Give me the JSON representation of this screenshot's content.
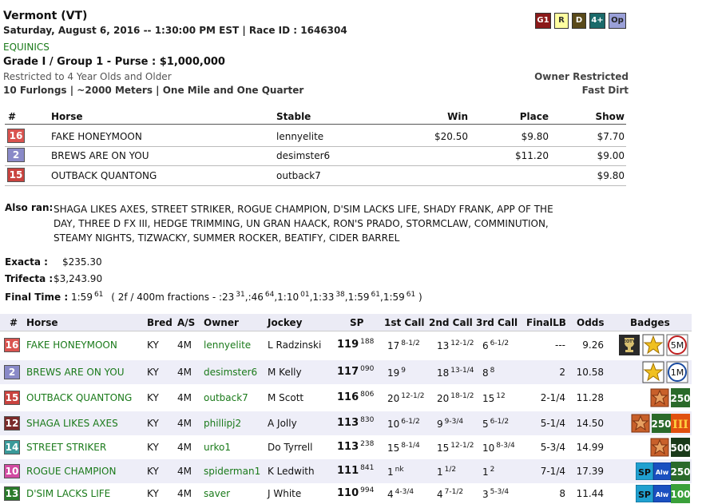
{
  "header": {
    "track": "Vermont (VT)",
    "datetime": "Saturday, August 6, 2016 -- 1:30:00 PM EST | Race ID : 1646304",
    "sponsor": "EQUINICS",
    "grade_purse": "Grade I / Group 1 - Purse : $1,000,000",
    "restriction": "Restricted to 4 Year Olds and Older",
    "distance": "10 Furlongs | ~2000 Meters | One Mile and One Quarter",
    "owner_restricted": "Owner Restricted",
    "surface": "Fast Dirt",
    "badges": [
      {
        "label": "G1",
        "bg": "#8b1a1a",
        "fg": "#ffffff"
      },
      {
        "label": "R",
        "bg": "#ffffa0",
        "fg": "#333333"
      },
      {
        "label": "D",
        "bg": "#5a4a1a",
        "fg": "#ffffff"
      },
      {
        "label": "4+",
        "bg": "#1a6a6a",
        "fg": "#ffffff"
      },
      {
        "label": "Op",
        "bg": "#9aa0d8",
        "fg": "#222222"
      }
    ]
  },
  "results": {
    "headers": {
      "num": "#",
      "horse": "Horse",
      "stable": "Stable",
      "win": "Win",
      "place": "Place",
      "show": "Show"
    },
    "rows": [
      {
        "pp": "16",
        "pp_color": "#d9534f",
        "horse": "FAKE HONEYMOON",
        "stable": "lennyelite",
        "win": "$20.50",
        "place": "$9.80",
        "show": "$7.70"
      },
      {
        "pp": "2",
        "pp_color": "#8a8ac8",
        "horse": "BREWS ARE ON YOU",
        "stable": "desimster6",
        "win": "",
        "place": "$11.20",
        "show": "$9.00"
      },
      {
        "pp": "15",
        "pp_color": "#c9433f",
        "horse": "OUTBACK QUANTONG",
        "stable": "outback7",
        "win": "",
        "place": "",
        "show": "$9.80"
      }
    ]
  },
  "also_ran": {
    "label": "Also ran:",
    "lines": [
      "SHAGA LIKES AXES, STREET STRIKER, ROGUE CHAMPION, D'SIM LACKS LIFE, SHADY FRANK, APP OF THE",
      "DAY, THREE D FX III, HEDGE TRIMMING, UN GRAN HAACK, RON'S PRADO, STORMCLAW, COMMINUTION,",
      "STEAMY NIGHTS, TIZWACKY, SUMMER ROCKER, BEATIFY, CIDER BARREL"
    ]
  },
  "payouts": {
    "exacta_label": "Exacta :",
    "exacta": "$235.30",
    "trifecta_label": "Trifecta :",
    "trifecta": "$3,243.90"
  },
  "final_time": {
    "label": "Final Time :",
    "time": "1:59",
    "time_sup": "61",
    "fractions_prefix": "( 2f / 400m fractions - :23",
    "fractions": [
      {
        "v": "31",
        "t": ",:46"
      },
      {
        "v": "64",
        "t": ",1:10"
      },
      {
        "v": "01",
        "t": ",1:33"
      },
      {
        "v": "38",
        "t": ",1:59"
      },
      {
        "v": "61",
        "t": ",1:59"
      },
      {
        "v": "61",
        "t": " )"
      }
    ]
  },
  "chart": {
    "headers": {
      "num": "#",
      "horse": "Horse",
      "bred": "Bred",
      "as": "A/S",
      "owner": "Owner",
      "jockey": "Jockey",
      "sp": "SP",
      "c1": "1st Call",
      "c2": "2nd Call",
      "c3": "3rd Call",
      "flb": "FinalLB",
      "odds": "Odds",
      "badges": "Badges"
    },
    "rows": [
      {
        "pp": "16",
        "pp_color": "#d9534f",
        "horse": "FAKE HONEYMOON",
        "bred": "KY",
        "as": "4M",
        "owner": "lennyelite",
        "jockey": "L Radzinski",
        "sp": "119",
        "sp_sup": "188",
        "c1": "17",
        "c1s": "8-1/2",
        "c2": "13",
        "c2s": "12-1/2",
        "c3": "6",
        "c3s": "6-1/2",
        "flb": "---",
        "odds": "9.26",
        "badges": [
          "eoty",
          "star",
          "5M"
        ]
      },
      {
        "pp": "2",
        "pp_color": "#8a8ac8",
        "horse": "BREWS ARE ON YOU",
        "bred": "KY",
        "as": "4M",
        "owner": "desimster6",
        "jockey": "M Kelly",
        "sp": "117",
        "sp_sup": "090",
        "c1": "19",
        "c1s": "9",
        "c2": "18",
        "c2s": "13-1/4",
        "c3": "8",
        "c3s": "8",
        "flb": "2",
        "odds": "10.58",
        "badges": [
          "star",
          "1M"
        ]
      },
      {
        "pp": "15",
        "pp_color": "#c9433f",
        "horse": "OUTBACK QUANTONG",
        "bred": "KY",
        "as": "4M",
        "owner": "outback7",
        "jockey": "M Scott",
        "sp": "116",
        "sp_sup": "806",
        "c1": "20",
        "c1s": "12-1/2",
        "c2": "20",
        "c2s": "18-1/2",
        "c3": "15",
        "c3s": "12",
        "flb": "2-1/4",
        "odds": "11.28",
        "badges": [
          "g3",
          "250"
        ]
      },
      {
        "pp": "12",
        "pp_color": "#7a2a2a",
        "horse": "SHAGA LIKES AXES",
        "bred": "KY",
        "as": "4M",
        "owner": "phillipj2",
        "jockey": "A Jolly",
        "sp": "113",
        "sp_sup": "830",
        "c1": "10",
        "c1s": "6-1/2",
        "c2": "9",
        "c2s": "9-3/4",
        "c3": "5",
        "c3s": "6-1/2",
        "flb": "5-1/4",
        "odds": "14.50",
        "badges": [
          "g3",
          "250",
          "III"
        ]
      },
      {
        "pp": "14",
        "pp_color": "#3a9a9a",
        "horse": "STREET STRIKER",
        "bred": "KY",
        "as": "4M",
        "owner": "urko1",
        "jockey": "Do Tyrrell",
        "sp": "113",
        "sp_sup": "238",
        "c1": "15",
        "c1s": "8-1/4",
        "c2": "15",
        "c2s": "12-1/2",
        "c3": "10",
        "c3s": "8-3/4",
        "flb": "5-3/4",
        "odds": "14.99",
        "badges": [
          "g3",
          "500"
        ]
      },
      {
        "pp": "10",
        "pp_color": "#d24aa2",
        "horse": "ROGUE CHAMPION",
        "bred": "KY",
        "as": "4M",
        "owner": "spiderman1",
        "jockey": "K Ledwith",
        "sp": "111",
        "sp_sup": "841",
        "c1": "1",
        "c1s": "nk",
        "c2": "1",
        "c2s": "1/2",
        "c3": "1",
        "c3s": "2",
        "flb": "7-1/4",
        "odds": "17.39",
        "badges": [
          "SP",
          "Alw",
          "250"
        ]
      },
      {
        "pp": "13",
        "pp_color": "#2a7a2a",
        "horse": "D'SIM LACKS LIFE",
        "bred": "KY",
        "as": "4M",
        "owner": "saver",
        "jockey": "J White",
        "sp": "110",
        "sp_sup": "994",
        "c1": "4",
        "c1s": "4-3/4",
        "c2": "4",
        "c2s": "7-1/2",
        "c3": "3",
        "c3s": "5-3/4",
        "flb": "8",
        "odds": "11.44",
        "badges": [
          "SP",
          "Alw",
          "100"
        ]
      }
    ]
  }
}
